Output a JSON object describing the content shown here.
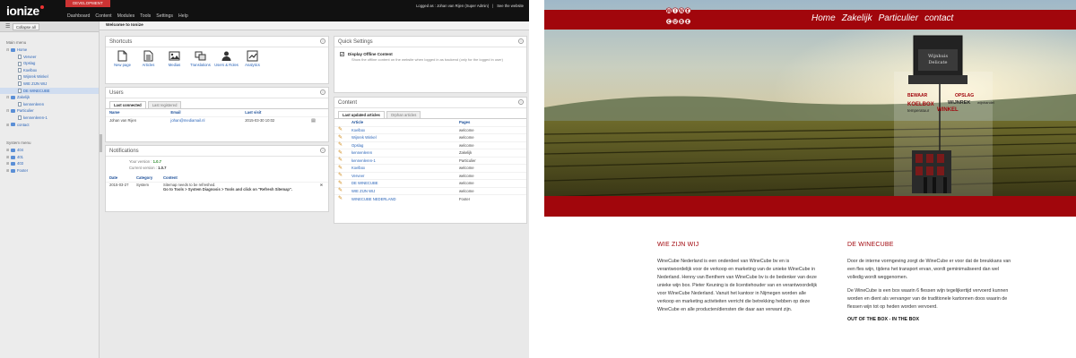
{
  "admin": {
    "logo": "ionize",
    "dev_badge": "DEVELOPMENT",
    "menu": [
      "Dashboard",
      "Content",
      "Modules",
      "Tools",
      "Settings",
      "Help"
    ],
    "logged_as": "Logged as : Johan van Rijen (Super Admin)",
    "see_website": "See the website",
    "collapse_all": "Collapse all",
    "main_menu_title": "Main menu",
    "tree": [
      {
        "label": "Home",
        "depth": 0,
        "kind": "folder",
        "expander": "⊟"
      },
      {
        "label": "Verveer",
        "depth": 1,
        "kind": "page",
        "expander": ""
      },
      {
        "label": "Opslag",
        "depth": 1,
        "kind": "page",
        "expander": ""
      },
      {
        "label": "Koelbox",
        "depth": 1,
        "kind": "page",
        "expander": ""
      },
      {
        "label": "Wijnrek Winkel",
        "depth": 1,
        "kind": "page",
        "expander": ""
      },
      {
        "label": "WIE ZIJN WIJ",
        "depth": 1,
        "kind": "page",
        "expander": ""
      },
      {
        "label": "DE WINECUBE",
        "depth": 1,
        "kind": "page",
        "expander": ""
      },
      {
        "label": "Zakelijk",
        "depth": 0,
        "kind": "folder",
        "expander": "⊟"
      },
      {
        "label": "kennenleren",
        "depth": 1,
        "kind": "page",
        "expander": ""
      },
      {
        "label": "Particulier",
        "depth": 0,
        "kind": "folder",
        "expander": "⊟"
      },
      {
        "label": "kennenleren-1",
        "depth": 1,
        "kind": "page",
        "expander": ""
      },
      {
        "label": "contact",
        "depth": 0,
        "kind": "folder",
        "expander": "⊞"
      }
    ],
    "system_menu_title": "System menu",
    "system_tree": [
      {
        "label": "404",
        "expander": "⊞"
      },
      {
        "label": "401",
        "expander": "⊞"
      },
      {
        "label": "403",
        "expander": "⊞"
      },
      {
        "label": "Footer",
        "expander": "⊞"
      }
    ],
    "welcome": "Welcome to Ionize",
    "shortcuts_title": "Shortcuts",
    "shortcuts": [
      {
        "label": "New page",
        "icon": "new-page-icon"
      },
      {
        "label": "Articles",
        "icon": "articles-icon"
      },
      {
        "label": "Medias",
        "icon": "medias-icon"
      },
      {
        "label": "Translations",
        "icon": "translations-icon"
      },
      {
        "label": "Users & Roles",
        "icon": "users-roles-icon"
      },
      {
        "label": "Analytics",
        "icon": "analytics-icon"
      }
    ],
    "users_title": "Users",
    "users_tabs": [
      "Last connected",
      "Last registered"
    ],
    "users_headers": [
      "Name",
      "Email",
      "Last visit"
    ],
    "users_rows": [
      {
        "name": "Johan van Rijen",
        "email": "johan@mediamail.nl",
        "visit": "2015-03-30 10:02"
      }
    ],
    "notifications_title": "Notifications",
    "your_version_label": "Your version :",
    "your_version": "1.0.7",
    "current_version_label": "Current version :",
    "current_version": "1.0.7",
    "notif_headers": [
      "Date",
      "Category",
      "Content"
    ],
    "notif_date": "2015-03-27",
    "notif_category": "System",
    "notif_line1": "Sitemap needs to be refreshed.",
    "notif_line2": "Go to Tools > System Diagnosis > Tools and click on \"Refresh Sitemap\".",
    "quick_settings_title": "Quick Settings",
    "qs_option_title": "Display Offline Content",
    "qs_option_desc": "Show the offline content on the website when logged in as backend (only for the logged in user)",
    "content_title": "Content",
    "content_tabs": [
      "Last updated articles",
      "Orphan articles"
    ],
    "content_headers": [
      "Article",
      "Pages"
    ],
    "articles": [
      {
        "title": "Koelbox",
        "page": "welcome"
      },
      {
        "title": "Wijnrek Winkel",
        "page": "welcome"
      },
      {
        "title": "Opslag",
        "page": "welcome"
      },
      {
        "title": "kennenleren",
        "page": "Zakelijk"
      },
      {
        "title": "kennenleren-1",
        "page": "Particulier"
      },
      {
        "title": "Koelbox",
        "page": "welcome"
      },
      {
        "title": "Verveer",
        "page": "welcome"
      },
      {
        "title": "DE WINECUBE",
        "page": "welcome"
      },
      {
        "title": "WIE ZIJN WIJ",
        "page": "welcome"
      },
      {
        "title": "WINECUBE NEDERLAND",
        "page": "Footer"
      }
    ]
  },
  "site": {
    "nav": [
      "Home",
      "Zakelijk",
      "Particulier",
      "contact"
    ],
    "logo_letters": [
      "W",
      "I",
      "N",
      "E",
      "C",
      "U",
      "B",
      "E"
    ],
    "box_label_1": "Wijnhuis",
    "box_label_2": "Delicate",
    "promo_1a": "BEWAAR",
    "promo_1b": "KOELBOX",
    "promo_1c": "temperatuur",
    "promo_2a": "OPSLAG",
    "promo_2b": "WIJNREK",
    "promo_2c": "WINKEL",
    "promo_2d": "wijnhandel",
    "col1_title": "WIE ZIJN WIJ",
    "col1_text": "WineCube Nederland is een onderdeel van WineCube bv en is verantwoordelijk voor de verkoop en marketing van de unieke WineCube in Nederland. Henny van Benthem van WineCube bv is de bedenker van deze unieke wijn box. Pieter Keuning is de licentiehouder van en verantwoordelijk voor WineCube Nederland. Vanuit het kantoor in Nijmegen worden alle verkoop en marketing activiteiten verricht die betrekking hebben op deze WineCube en alle producten/diensten die daar aan verwant zijn.",
    "col2_title": "DE WINECUBE",
    "col2_text1": "Door de interne vormgeving zorgt de WineCube er voor dat de breukkans van een fles wijn, tijdens het transport ervan, wordt geminimaliseerd dan wel volledig wordt weggenomen.",
    "col2_text2": "De WineCube is een box waarin 6 flessen wijn tegelijkertijd vervoerd kunnen worden en dient als vervanger van de traditionele kartonnen doos waarin de flessen wijn tot op heden worden vervoerd.",
    "col2_subtitle": "OUT OF THE BOX - IN THE BOX"
  },
  "colors": {
    "brand_red": "#a1060c",
    "admin_dark": "#111111",
    "dev_red": "#cc3333",
    "link_blue": "#2a64b8"
  }
}
